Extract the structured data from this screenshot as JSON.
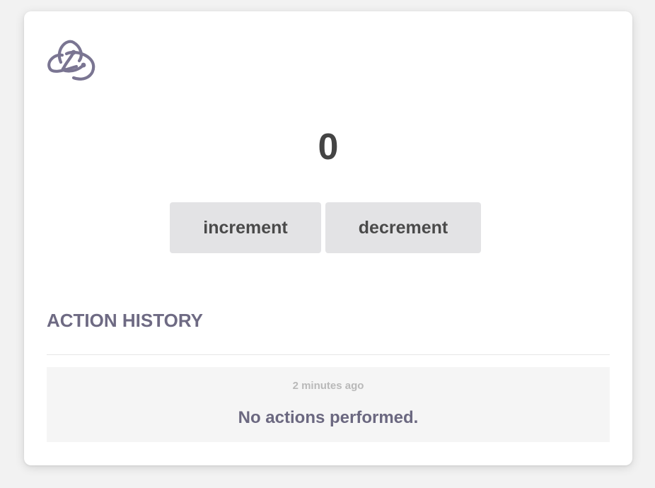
{
  "app": {
    "logo_icon": "redux-logo-icon",
    "logo_color": "#7a7592"
  },
  "counter": {
    "value": "0"
  },
  "buttons": {
    "increment_label": "increment",
    "decrement_label": "decrement"
  },
  "history": {
    "title": "ACTION HISTORY",
    "items": [
      {
        "time": "2 minutes ago",
        "text": "No actions performed."
      }
    ]
  },
  "colors": {
    "background": "#f2f2f2",
    "card": "#ffffff",
    "button_bg": "#e3e3e5",
    "accent_text": "#6e6a83"
  }
}
